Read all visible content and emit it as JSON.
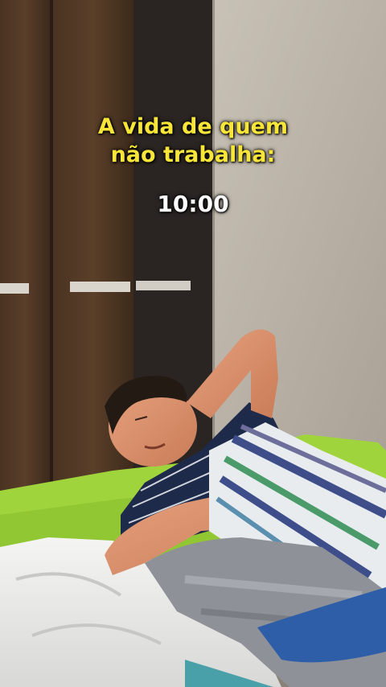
{
  "overlay": {
    "title_lines": [
      "A vida de quem",
      "não trabalha:"
    ],
    "time": "10:00"
  },
  "colors": {
    "caption_title": "#f7e53a",
    "caption_time": "#ffffff"
  }
}
